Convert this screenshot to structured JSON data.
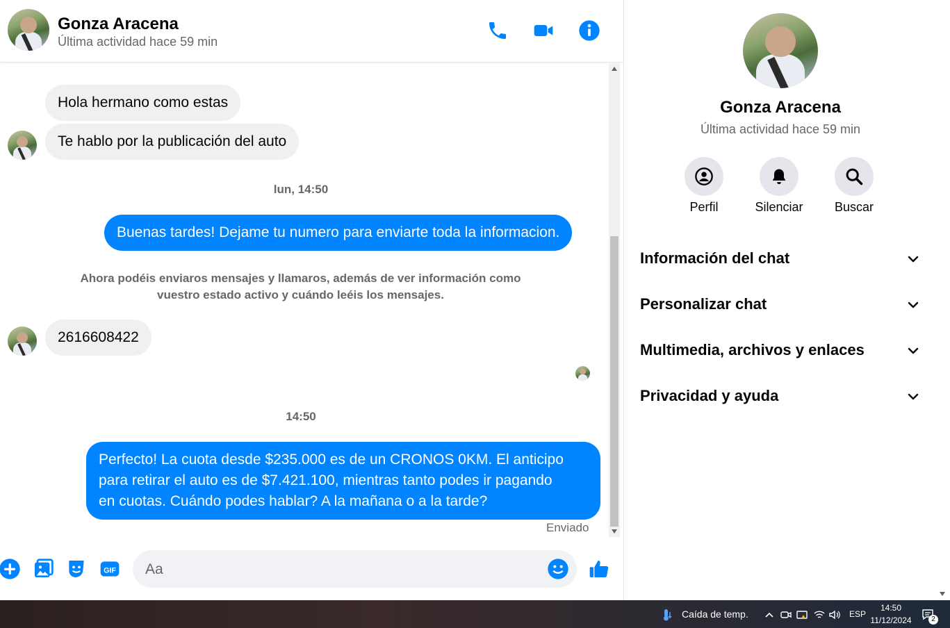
{
  "contact": {
    "name": "Gonza Aracena",
    "status": "Última actividad hace 59 min"
  },
  "messages": {
    "m1": "Hola hermano como estas",
    "m2": "Te hablo por la publicación del auto",
    "ts1": "lun, 14:50",
    "m3": "Buenas tardes! Dejame tu numero para enviarte toda la informacion.",
    "notice_line1": "Ahora podéis enviaros mensajes y llamaros, además de ver información como",
    "notice_line2": "vuestro estado activo y cuándo leéis los mensajes.",
    "m4": "2616608422",
    "ts2": "14:50",
    "m5_line1": "Perfecto! La cuota desde $235.000 es de un CRONOS 0KM. El anticipo",
    "m5_line2": "para retirar el auto es de $7.421.100, mientras tanto podes ir pagando",
    "m5_line3": "en cuotas. Cuándo podes hablar? A la mañana o a la tarde?",
    "delivery_status": "Enviado"
  },
  "composer": {
    "placeholder": "Aa"
  },
  "panel": {
    "actions": {
      "profile": "Perfil",
      "mute": "Silenciar",
      "search": "Buscar"
    },
    "sections": {
      "chat_info": "Información del chat",
      "customize": "Personalizar chat",
      "media": "Multimedia, archivos y enlaces",
      "privacy": "Privacidad y ayuda"
    }
  },
  "taskbar": {
    "weather": "Caída de temp.",
    "language": "ESP",
    "time": "14:50",
    "date": "11/12/2024",
    "notifications": "2"
  },
  "colors": {
    "accent": "#0084ff",
    "bubble_in": "#f0f0f0",
    "muted_text": "#65676b"
  }
}
